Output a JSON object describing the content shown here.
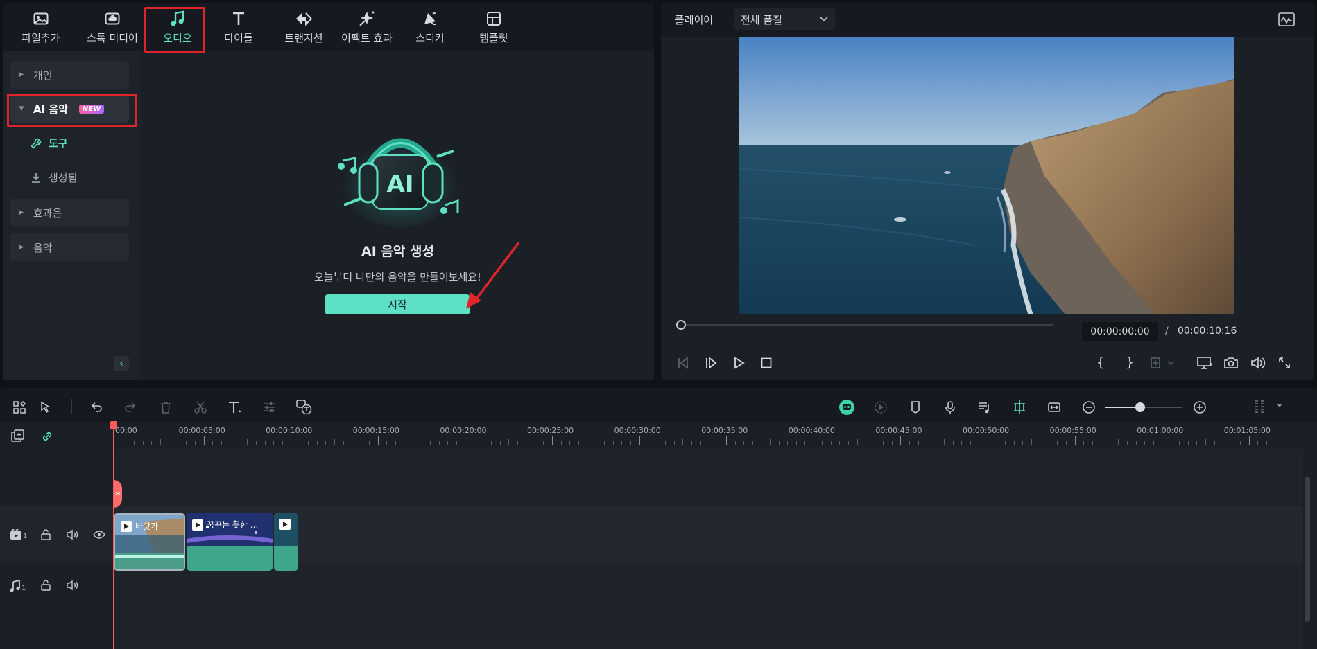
{
  "library": {
    "tabs": [
      {
        "label": "파일추가",
        "icon": "import-media-icon"
      },
      {
        "label": "스톡 미디어",
        "icon": "cloud-icon"
      },
      {
        "label": "오디오",
        "icon": "music-note-icon"
      },
      {
        "label": "타이틀",
        "icon": "title-t-icon"
      },
      {
        "label": "트랜지션",
        "icon": "transition-icon"
      },
      {
        "label": "이펙트 효과",
        "icon": "sparkle-effect-icon"
      },
      {
        "label": "스티커",
        "icon": "sticker-icon"
      },
      {
        "label": "템플릿",
        "icon": "template-icon"
      }
    ],
    "active_tab": "오디오",
    "sidebar": {
      "personal": "개인",
      "ai_music": "AI 음악",
      "new_badge": "NEW",
      "tool": "도구",
      "generated": "생성됨",
      "sound_effects": "효과음",
      "music": "음악"
    },
    "center": {
      "logo_text": "AI",
      "title": "AI 음악 생성",
      "description": "오늘부터 나만의 음악을 만들어보세요!",
      "start_button": "시작"
    }
  },
  "player": {
    "label": "플레이어",
    "quality": "전체 품질",
    "current_time": "00:00:00:00",
    "separator": "/",
    "total_time": "00:00:10:16",
    "progress": 0
  },
  "timeline": {
    "ruler": [
      "00:00",
      "00:00:05:00",
      "00:00:10:00",
      "00:00:15:00",
      "00:00:20:00",
      "00:00:25:00",
      "00:00:30:00",
      "00:00:35:00",
      "00:00:40:00",
      "00:00:45:00",
      "00:00:50:00",
      "00:00:55:00",
      "00:01:00:00",
      "00:01:05:00"
    ],
    "video_track_num": "1",
    "audio_track_num": "1",
    "clips": [
      {
        "title": "바닷가"
      },
      {
        "title": "꿈꾸는 듯한 ..."
      },
      {
        "title": ""
      }
    ],
    "zoom_level": 0.45
  },
  "colors": {
    "accent": "#5de0c3",
    "highlight": "#e0242b",
    "playhead": "#ff5b5b"
  }
}
